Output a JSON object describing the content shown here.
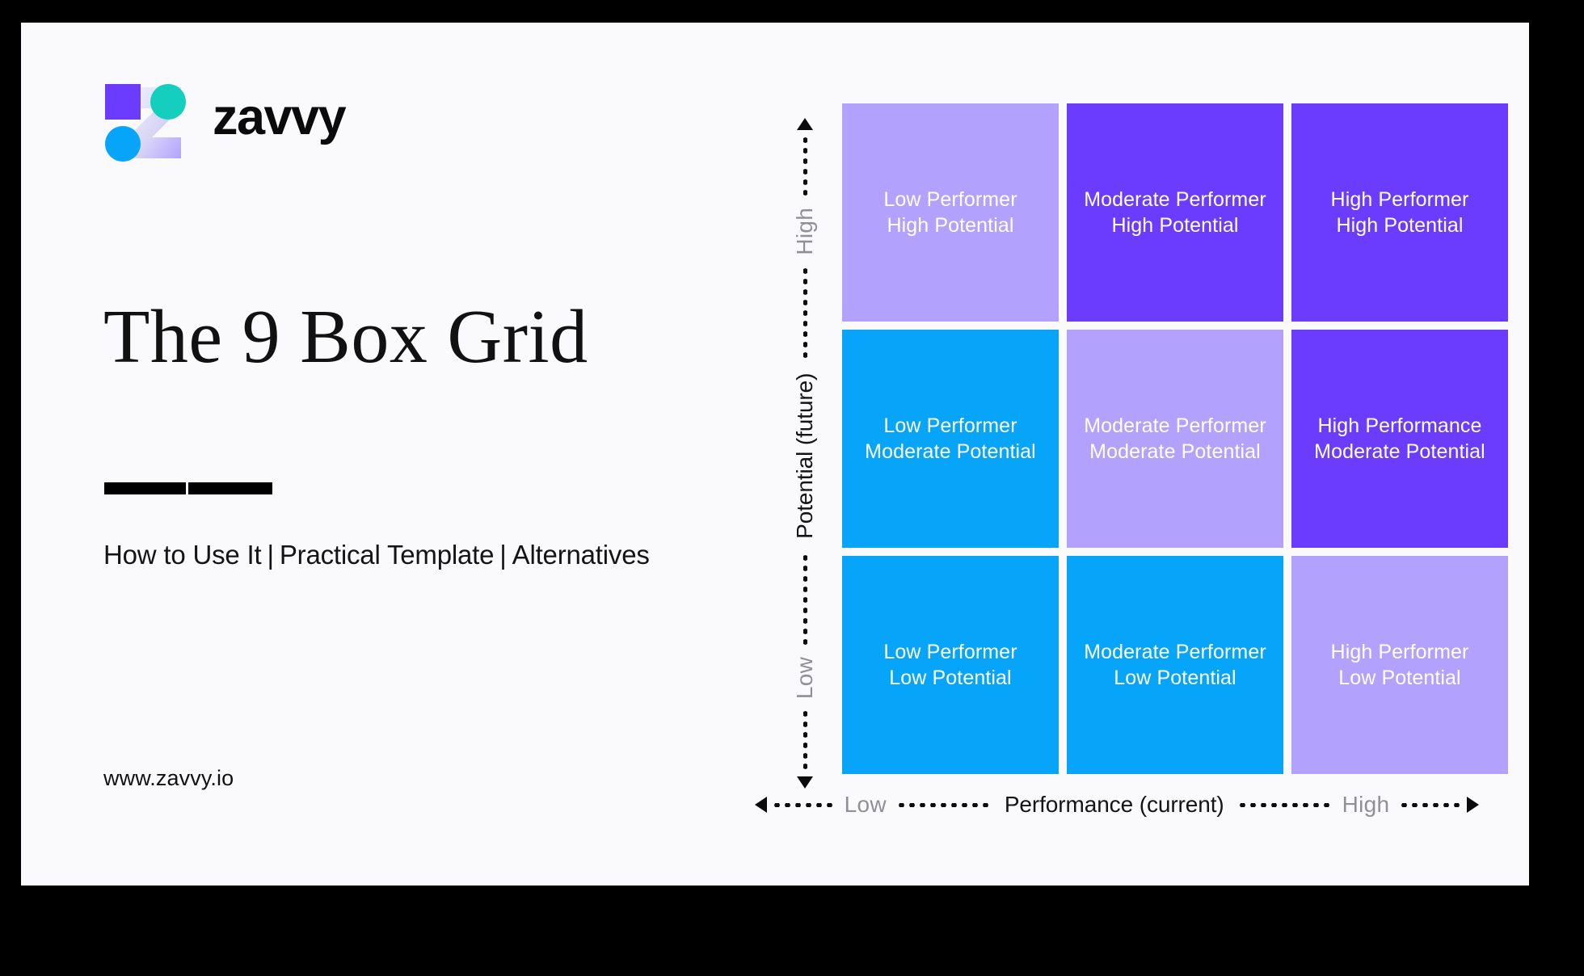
{
  "brand": {
    "wordmark": "zavvy",
    "logo_icon": "zavvy-z-logo-icon",
    "colors": {
      "purple_square": "#6B3CFD",
      "teal_circle": "#15CFBE",
      "blue_circle": "#06A5FA",
      "lavender": "#B2A2FE"
    }
  },
  "left": {
    "headline": "The 9 Box Grid",
    "subtitle": {
      "part1": "How to Use It",
      "part2": "Practical Template",
      "part3": "Alternatives",
      "separator": "|"
    },
    "url": "www.zavvy.io"
  },
  "chart_data": {
    "type": "heatmap",
    "title": "The 9 Box Grid",
    "xlabel": "Performance (current)",
    "ylabel": "Potential (future)",
    "x_low_label": "Low",
    "x_high_label": "High",
    "y_low_label": "Low",
    "y_high_label": "High",
    "x_categories": [
      "Low",
      "Moderate",
      "High"
    ],
    "y_categories": [
      "High",
      "Moderate",
      "Low"
    ],
    "grid": false,
    "legend": "none",
    "palette": {
      "lavender": "#B2A2FE",
      "purple": "#6B3CFD",
      "cyan": "#06A5FA"
    },
    "cells": [
      {
        "row": 0,
        "col": 0,
        "line1": "Low Performer",
        "line2": "High Potential",
        "color": "#B2A2FE",
        "value": 1
      },
      {
        "row": 0,
        "col": 1,
        "line1": "Moderate Performer",
        "line2": "High Potential",
        "color": "#6B3CFD",
        "value": 2
      },
      {
        "row": 0,
        "col": 2,
        "line1": "High Performer",
        "line2": "High Potential",
        "color": "#6B3CFD",
        "value": 2
      },
      {
        "row": 1,
        "col": 0,
        "line1": "Low Performer",
        "line2": "Moderate Potential",
        "color": "#06A5FA",
        "value": 0
      },
      {
        "row": 1,
        "col": 1,
        "line1": "Moderate Performer",
        "line2": "Moderate Potential",
        "color": "#B2A2FE",
        "value": 1
      },
      {
        "row": 1,
        "col": 2,
        "line1": "High Performance",
        "line2": "Moderate Potential",
        "color": "#6B3CFD",
        "value": 2
      },
      {
        "row": 2,
        "col": 0,
        "line1": "Low Performer",
        "line2": "Low Potential",
        "color": "#06A5FA",
        "value": 0
      },
      {
        "row": 2,
        "col": 1,
        "line1": "Moderate Performer",
        "line2": "Low Potential",
        "color": "#06A5FA",
        "value": 0
      },
      {
        "row": 2,
        "col": 2,
        "line1": "High Performer",
        "line2": "Low Potential",
        "color": "#B2A2FE",
        "value": 1
      }
    ]
  }
}
